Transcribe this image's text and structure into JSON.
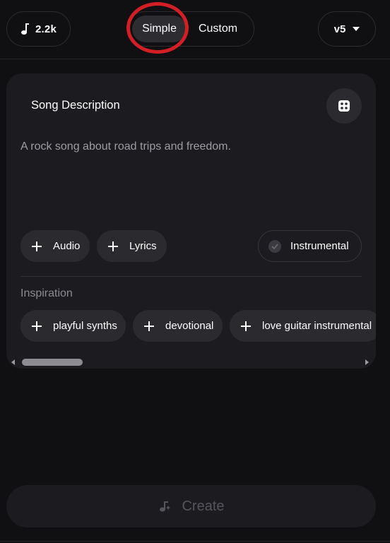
{
  "header": {
    "credits": "2.2k",
    "modes": {
      "simple": "Simple",
      "custom": "Custom",
      "active": "Simple"
    },
    "version": "v5"
  },
  "card": {
    "title": "Song Description",
    "description": "A rock song about road trips and freedom.",
    "chips": {
      "audio": "Audio",
      "lyrics": "Lyrics",
      "instrumental": "Instrumental"
    },
    "inspiration_label": "Inspiration",
    "inspirations": [
      "playful synths",
      "devotional",
      "love guitar instrumental"
    ]
  },
  "create_label": "Create",
  "colors": {
    "background": "#101012",
    "card": "#1c1c20",
    "highlight": "#d21f26"
  },
  "icons": [
    "music-note-icon",
    "chevron-down-icon",
    "dice-icon",
    "plus-icon",
    "check-icon",
    "create-music-icon"
  ]
}
